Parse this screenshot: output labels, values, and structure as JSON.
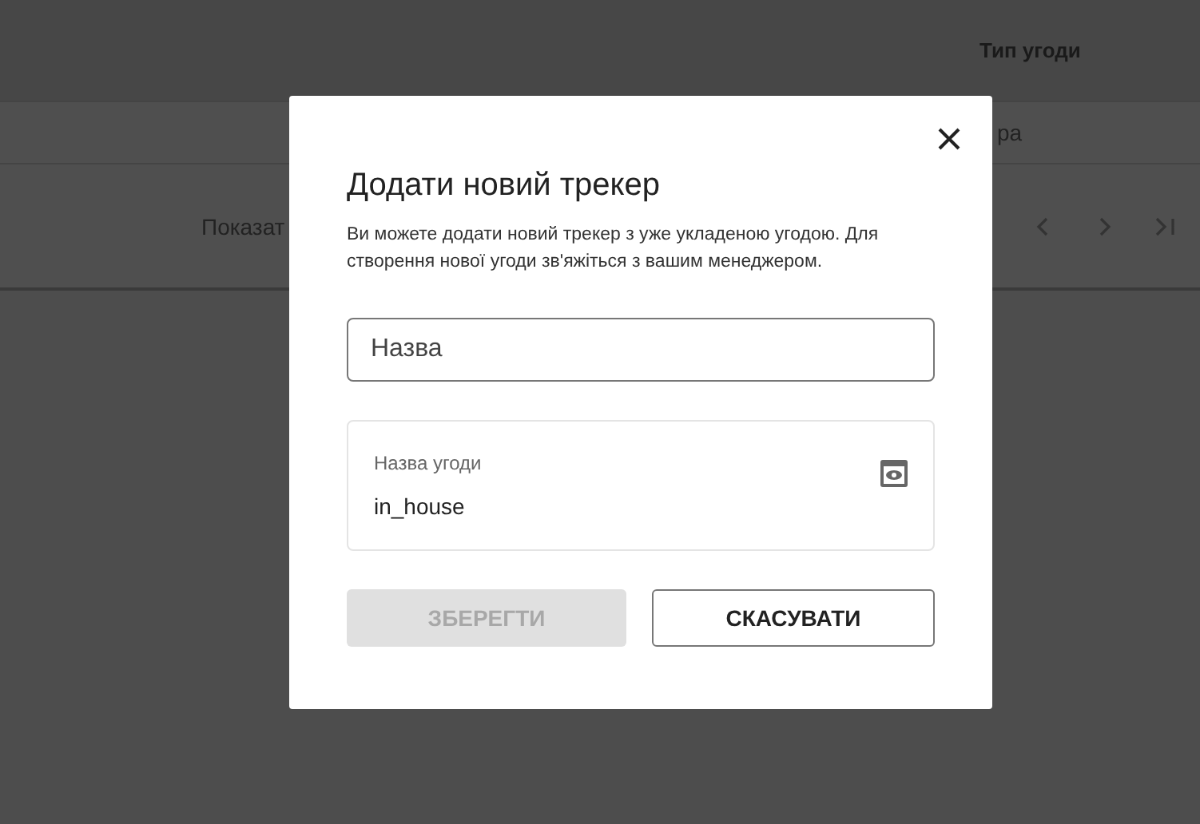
{
  "background_table": {
    "column_header": "Тип угоди",
    "row_cell": "ра",
    "pagination_label": "Показат"
  },
  "dialog": {
    "title": "Додати новий трекер",
    "description": "Ви можете додати новий трекер з уже укладеною угодою. Для створення нової угоди зв'яжіться з вашим менеджером.",
    "name_field": {
      "placeholder": "Назва"
    },
    "deal_field": {
      "label": "Назва угоди",
      "value": "in_house"
    },
    "buttons": [
      {
        "label": "ЗБЕРЕГТИ",
        "kind": "primary",
        "disabled": true
      },
      {
        "label": "СКАСУВАТИ",
        "kind": "outline",
        "disabled": false
      }
    ]
  }
}
